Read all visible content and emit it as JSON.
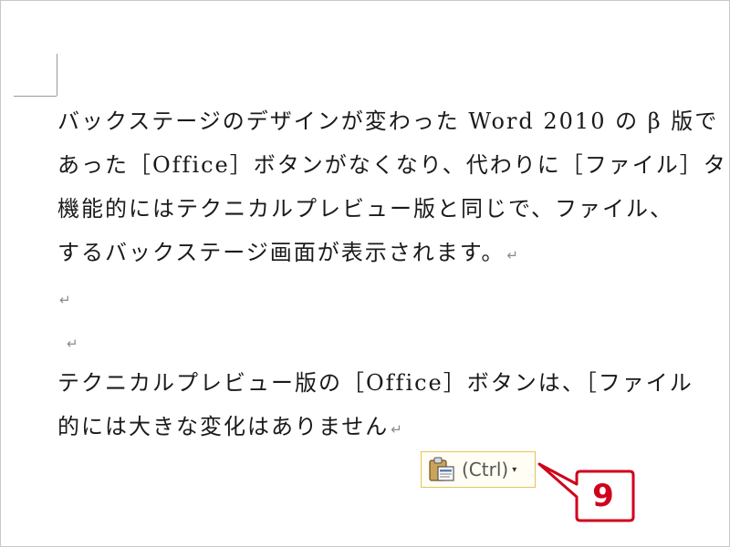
{
  "document": {
    "paragraph1": [
      "バックステージのデザインが変わった Word 2010 の β 版で",
      "あった［Office］ボタンがなくなり、代わりに［ファイル］タ",
      "機能的にはテクニカルプレビュー版と同じで、ファイル、",
      "するバックステージ画面が表示されます。"
    ],
    "paragraph2": [
      "テクニカルプレビュー版の［Office］ボタンは、［ファイル",
      "的には大きな変化はありません"
    ],
    "paragraph_mark": "↵"
  },
  "paste_options": {
    "label": "(Ctrl)",
    "icon": "clipboard-paste-icon",
    "caret": "▾"
  },
  "callout": {
    "number": "9",
    "color": "#d0021b"
  }
}
